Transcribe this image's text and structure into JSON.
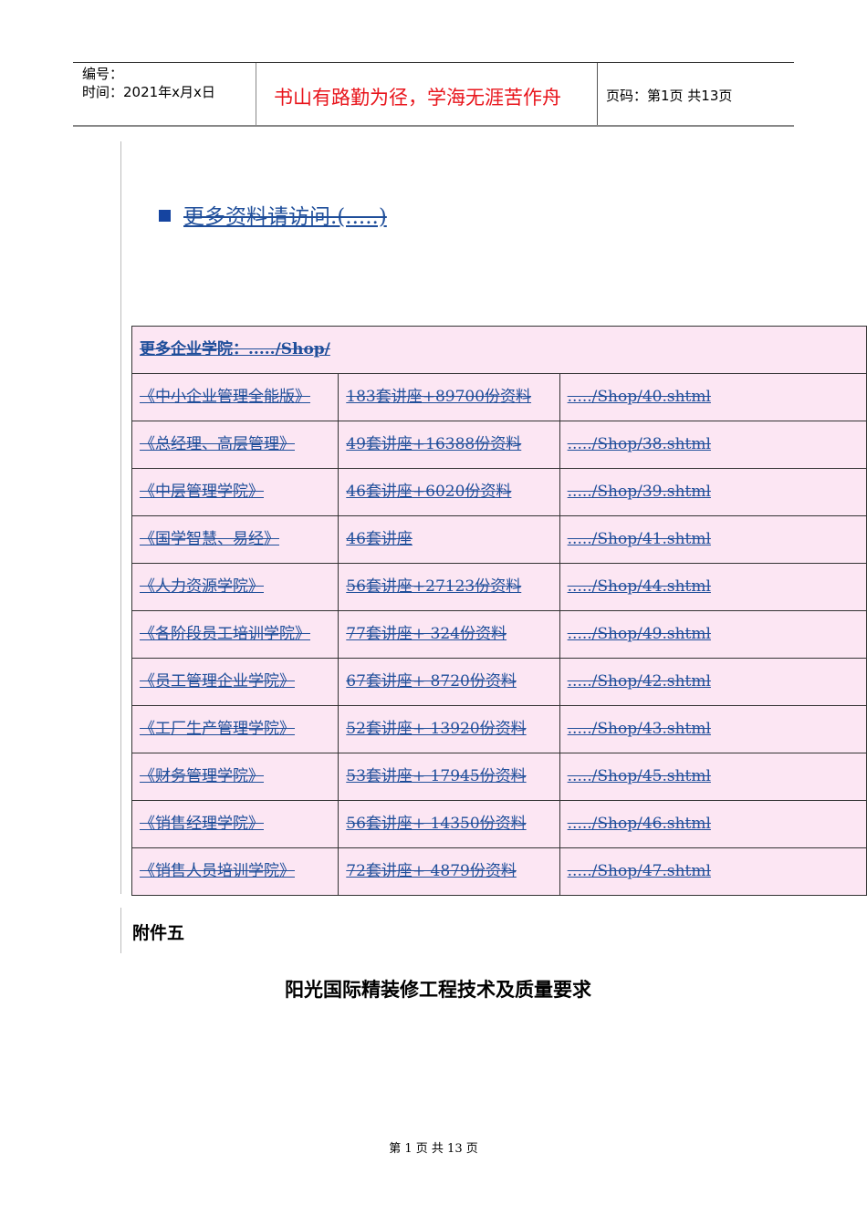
{
  "header": {
    "number_label": "编号：",
    "time_label": "时间：2021年x月x日",
    "motto": "书山有路勤为径，学海无涯苦作舟",
    "page_info": "页码：第1页  共13页"
  },
  "more_link": "更多资料请访问.(.....)",
  "table": {
    "header": "更多企业学院：...../Shop/",
    "rows": [
      [
        "《中小企业管理全能版》",
        "183套讲座+89700份资料",
        "...../Shop/40.shtml"
      ],
      [
        "《总经理、高层管理》",
        "49套讲座+16388份资料",
        "...../Shop/38.shtml"
      ],
      [
        "《中层管理学院》",
        "46套讲座+6020份资料",
        "...../Shop/39.shtml"
      ],
      [
        "《国学智慧、易经》",
        "46套讲座",
        "...../Shop/41.shtml"
      ],
      [
        "《人力资源学院》",
        "56套讲座+27123份资料",
        "...../Shop/44.shtml"
      ],
      [
        "《各阶段员工培训学院》",
        "77套讲座+ 324份资料",
        "...../Shop/49.shtml"
      ],
      [
        "《员工管理企业学院》",
        "67套讲座+ 8720份资料",
        "...../Shop/42.shtml"
      ],
      [
        "《工厂生产管理学院》",
        "52套讲座+ 13920份资料",
        "...../Shop/43.shtml"
      ],
      [
        "《财务管理学院》",
        "53套讲座+ 17945份资料",
        "...../Shop/45.shtml"
      ],
      [
        "《销售经理学院》",
        "56套讲座+ 14350份资料",
        "...../Shop/46.shtml"
      ],
      [
        "《销售人员培训学院》",
        "72套讲座+ 4879份资料",
        "...../Shop/47.shtml"
      ]
    ]
  },
  "attachment": "附件五",
  "doc_title": "阳光国际精装修工程技术及质量要求",
  "footer": "第 1 页 共 13 页"
}
